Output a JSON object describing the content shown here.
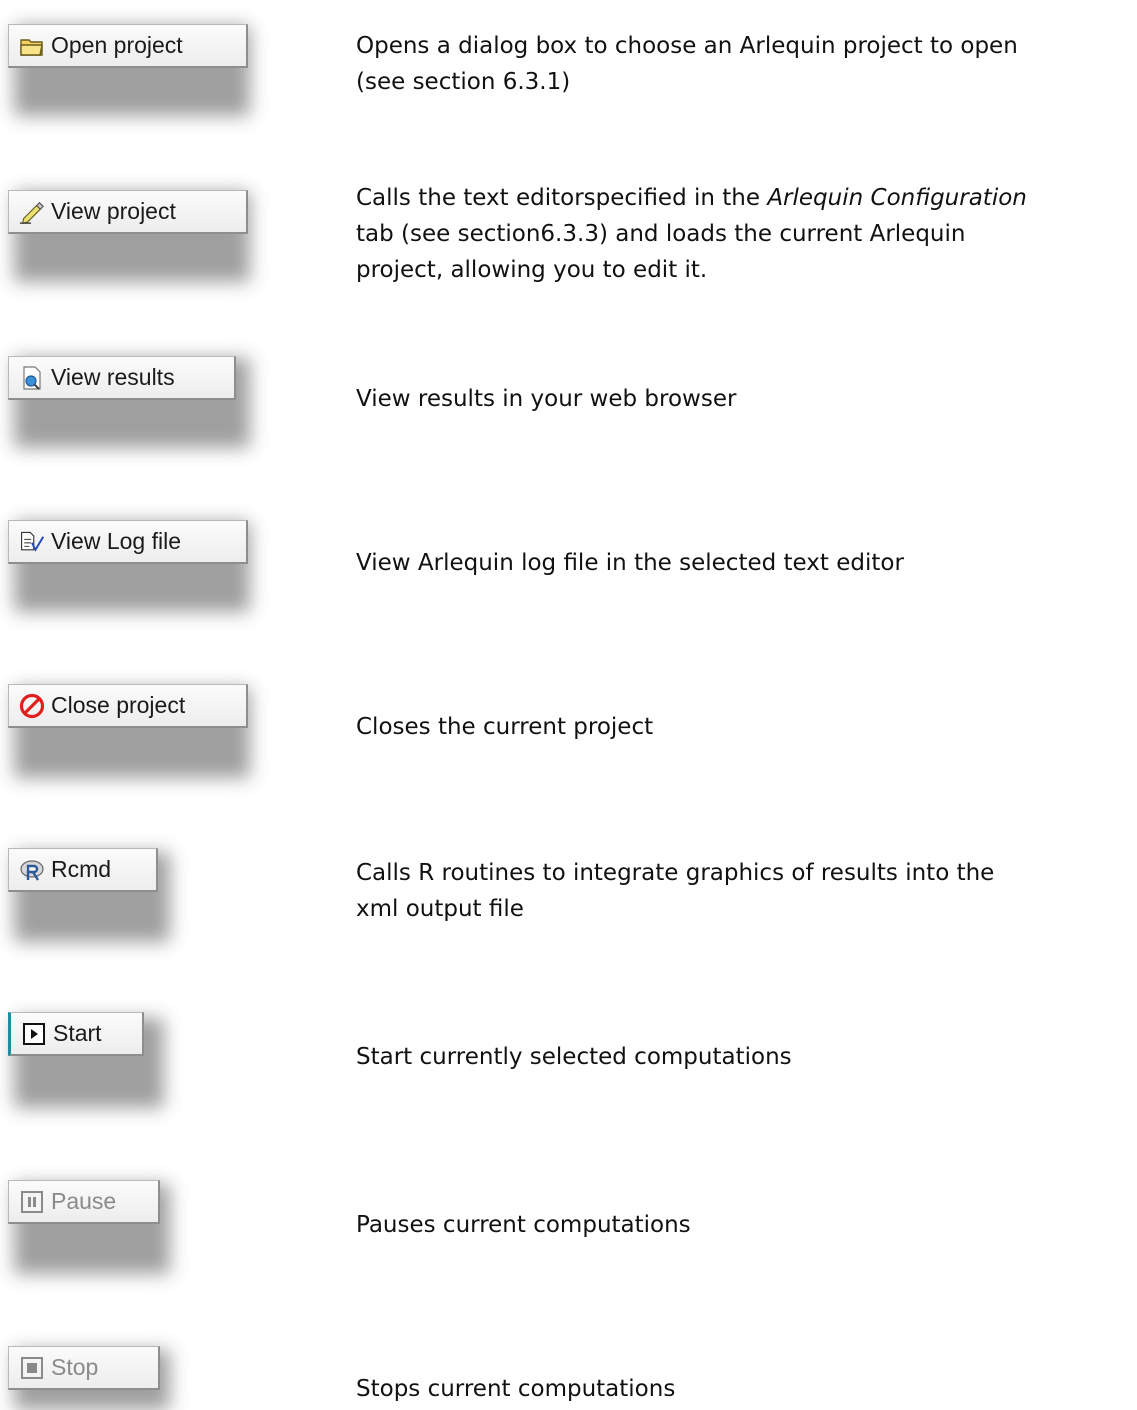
{
  "buttons": [
    {
      "label": "Open project",
      "icon": "folder-icon",
      "enabled": true,
      "desc": [
        "Opens a dialog box to choose an Arlequin project to open",
        "(see section 6.3.1)"
      ]
    },
    {
      "label": "View project",
      "icon": "pencil-icon",
      "enabled": true,
      "desc_a": "Calls the text editorspecified in the ",
      "desc_em": "Arlequin Configuration",
      "desc_b": "tab (see section6.3.3) and loads the current Arlequin",
      "desc_c": "project, allowing you to edit it."
    },
    {
      "label": "View results",
      "icon": "document-search-icon",
      "enabled": true,
      "desc": [
        "View results in your web browser"
      ]
    },
    {
      "label": "View Log file",
      "icon": "log-check-icon",
      "enabled": true,
      "desc": [
        "View Arlequin log file in the selected text editor"
      ]
    },
    {
      "label": "Close project",
      "icon": "prohibited-icon",
      "enabled": true,
      "desc": [
        "Closes the current project"
      ]
    },
    {
      "label": "Rcmd",
      "icon": "r-logo-icon",
      "enabled": true,
      "desc": [
        "Calls R routines to integrate graphics of results into the",
        "xml output file"
      ]
    },
    {
      "label": "Start",
      "icon": "play-icon",
      "enabled": true,
      "desc": [
        "Start currently selected computations"
      ]
    },
    {
      "label": "Pause",
      "icon": "pause-icon",
      "enabled": false,
      "desc": [
        "Pauses current computations"
      ]
    },
    {
      "label": "Stop",
      "icon": "stop-icon",
      "enabled": false,
      "desc": [
        "Stops current computations"
      ]
    }
  ],
  "colors": {
    "start_icon_accent": "#1a8fa0",
    "close_icon_red": "#e0201c",
    "folder_yellow": "#f2d060"
  }
}
